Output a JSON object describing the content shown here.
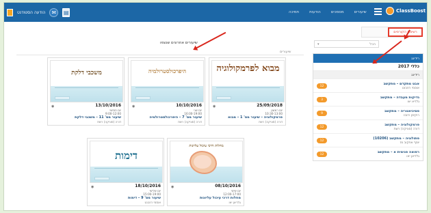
{
  "topbar": {
    "user_label": "הודעה הסטודנט",
    "nav": [
      "תמיכה",
      "הודעות",
      "מסמכים",
      "שיעורים"
    ],
    "logo_text": "ClassBoost"
  },
  "tab_label": "רשימת הקורסים",
  "filter": {
    "selected": "הכל"
  },
  "main": {
    "section_title": "שיעורים אחרונים שנצפו",
    "crumb": "שיעורים"
  },
  "sidebar": {
    "header": "רידינג",
    "year": "כללי 2017",
    "sub": "רידינג",
    "items": [
      {
        "title": "אבט מתקדם – מתקשב",
        "sub": "אוסמי רוזבנט",
        "badge": "12"
      },
      {
        "title": "גדיקות מעבדה – מתקשב",
        "sub": "גלדיא יאו",
        "badge": "3"
      },
      {
        "title": "פסיכיאטריה – מתקשב",
        "sub": "רוקיסן רוזבנ",
        "badge": "9"
      },
      {
        "title": "פרמקולוגיה – מתקשב",
        "sub": "דורה (סוניקה) רשת",
        "badge": "12"
      },
      {
        "title": "פתולוגיה – מתקשב (10206)",
        "sub": "יוסף אפקוב מז",
        "badge": "12"
      },
      {
        "title": "רפואה פנימית א – מתקשב",
        "sub": "גלדיאן יאו",
        "badge": "12"
      }
    ]
  },
  "cards": [
    {
      "thumb_title": "מבוא לפרמקולוגיה",
      "date": "25/09/2018",
      "day": "יום ראשון",
      "hour": "10:30-13:00",
      "name": "פרמקולוגיה – שיעור מס' 1 – מבוא",
      "teacher": "דורה (סוניקה) רשת"
    },
    {
      "thumb_title": "היפרכולסטרולמיה",
      "date": "10/10/2016",
      "day": "יום שני",
      "hour": "16:00-19:00",
      "name": "שיעור מס' 7 – היפרכולסטרולמיה",
      "teacher": "דורה (סוניקה) רשת"
    },
    {
      "thumb_title": "משכבי דלקת",
      "date": "13/10/2016",
      "day": "יום חמישי",
      "hour": "9:00-12:00",
      "name": "שיעור מס' 11 – משכבי דלקת",
      "teacher": "דורה (סוניקה) רשת"
    },
    {
      "thumb_title": "מחלות דרכי עיכול עליונות",
      "date": "08/10/2016",
      "day": "יום שישי",
      "hour": "12:00-17:00",
      "name": "מחלות דרכי עיכול עליונות",
      "teacher": "גלדיאן יאו"
    },
    {
      "thumb_title": "דימות",
      "date": "18/10/2016",
      "day": "יום שלישי",
      "hour": "15:00-19:00",
      "name": "שיעור מס' 9 – דימות",
      "teacher": "אוסמי רוזבנט"
    }
  ]
}
